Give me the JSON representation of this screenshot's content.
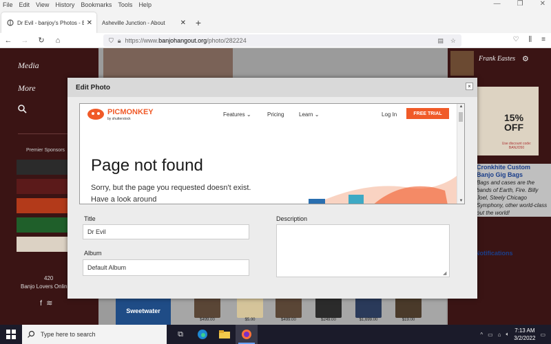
{
  "menu": {
    "items": [
      "File",
      "Edit",
      "View",
      "History",
      "Bookmarks",
      "Tools",
      "Help"
    ]
  },
  "tabs": [
    {
      "label": "Dr Evil - banjoy's Photos - Banjo H",
      "active": true
    },
    {
      "label": "Asheville Junction - About",
      "active": false
    }
  ],
  "address": {
    "prefix": "https://www.",
    "domain": "banjohangout.org",
    "path": "/photo/282224"
  },
  "site": {
    "nav": [
      "Media",
      "More"
    ],
    "sponsors_title": "Premier Sponsors",
    "lovers_count": "420",
    "lovers_label": "Banjo Lovers Online",
    "user_name": "Frank Eastes",
    "ad_percent": "15%",
    "ad_off": "OFF",
    "ad_code": "Use discount code: BANJO50",
    "right_link1": "Cronkhite Custom",
    "right_link2": "Banjo Gig Bags",
    "right_text": "Bags and cases are the bands of Earth, Fire. Billy Joel, Steely Chicago Symphony, other world-class out the world!",
    "notifications": "Notifications",
    "shop_name": "Sweetwater",
    "prices": [
      "$499.00",
      "$5.00",
      "$499.00",
      "$249.00",
      "$1,699.00",
      "$19.00"
    ]
  },
  "modal": {
    "title": "Edit Photo",
    "close": "×",
    "iframe": {
      "brand": "PICMONKEY",
      "brand_sub": "by shutterstock",
      "nav_features": "Features",
      "nav_pricing": "Pricing",
      "nav_learn": "Learn",
      "login": "Log In",
      "free_trial": "FREE TRIAL",
      "heading": "Page not found",
      "body": "Sorry, but the page you requested doesn't exist. Have a look around"
    },
    "form": {
      "title_label": "Title",
      "title_value": "Dr Evil",
      "album_label": "Album",
      "album_value": "Default Album",
      "description_label": "Description",
      "description_value": ""
    }
  },
  "taskbar": {
    "search_placeholder": "Type here to search",
    "time": "7:13 AM",
    "date": "3/2/2022"
  },
  "colors": {
    "accent_orange": "#f05a28",
    "site_maroon": "#3a1414",
    "link_blue": "#1b3f8b"
  }
}
